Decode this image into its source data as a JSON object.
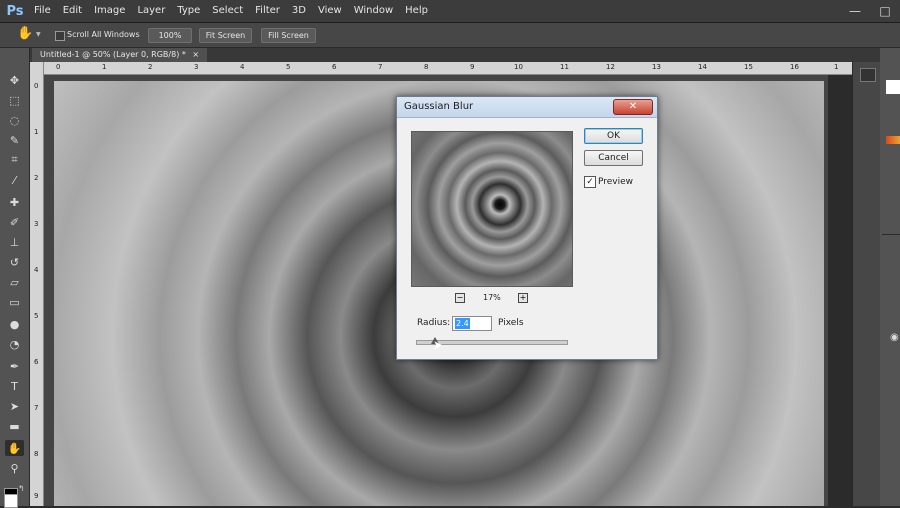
{
  "app": {
    "logo": "Ps"
  },
  "menu": [
    "File",
    "Edit",
    "Image",
    "Layer",
    "Type",
    "Select",
    "Filter",
    "3D",
    "View",
    "Window",
    "Help"
  ],
  "window_controls": {
    "minimize": "—",
    "maximize": "□",
    "close": "✕"
  },
  "options_bar": {
    "scroll_all_windows": "Scroll All Windows",
    "zoom_100": "100%",
    "fit_screen": "Fit Screen",
    "fill_screen": "Fill Screen"
  },
  "document_tab": {
    "label": "Untitled-1 @ 50% (Layer 0, RGB/8) *",
    "close": "×"
  },
  "ruler_top": [
    "0",
    "1",
    "2",
    "3",
    "4",
    "5",
    "6",
    "7",
    "8",
    "9",
    "10",
    "11",
    "12",
    "13",
    "14",
    "15",
    "16",
    "1"
  ],
  "ruler_left": [
    "0",
    "1",
    "2",
    "3",
    "4",
    "5",
    "6",
    "7",
    "8",
    "9"
  ],
  "dialog": {
    "title": "Gaussian Blur",
    "close": "✕",
    "ok": "OK",
    "cancel": "Cancel",
    "preview_label": "Preview",
    "preview_checked": "✓",
    "zoom_level": "17%",
    "zoom_out": "−",
    "zoom_in": "+",
    "radius_label": "Radius:",
    "radius_value": "2.4",
    "units": "Pixels"
  },
  "colors": {
    "menubar": "#3c3c3c",
    "toolbar": "#535353",
    "dialog": "#f0f0f0",
    "accent": "#3399ff"
  }
}
